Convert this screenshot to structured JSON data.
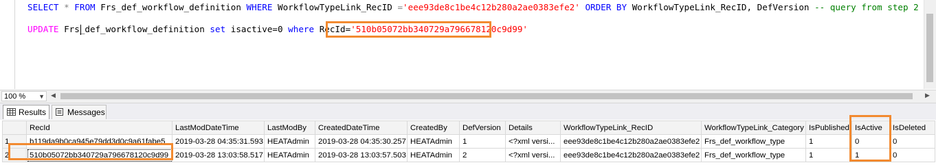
{
  "editor": {
    "line1": {
      "select": "SELECT",
      "star": "*",
      "from": "FROM",
      "table": "Frs_def_workflow_definition",
      "where": "WHERE",
      "col": "WorkflowTypeLink_RecID",
      "eq": "=",
      "value": "'eee93de8c1be4c12b280a2ae0383efe2'",
      "orderby": "ORDER BY",
      "order_cols": "WorkflowTypeLink_RecID, DefVersion",
      "comment": "-- query from step 2"
    },
    "line2": {
      "update": "UPDATE",
      "table": "Frs_def_workflow_definition",
      "set": "set",
      "assign": "isactive=0",
      "where": "where",
      "col": "RecId=",
      "value": "'510b05072bb340729a796678120c9d99'"
    }
  },
  "zoom": {
    "value": "100 %"
  },
  "tabs": [
    {
      "label": "Results",
      "icon": "grid-icon"
    },
    {
      "label": "Messages",
      "icon": "messages-icon"
    }
  ],
  "grid": {
    "columns": [
      "RecId",
      "LastModDateTime",
      "LastModBy",
      "CreatedDateTime",
      "CreatedBy",
      "DefVersion",
      "Details",
      "WorkflowTypeLink_RecID",
      "WorkflowTypeLink_Category",
      "IsPublished",
      "IsActive",
      "IsDeleted"
    ],
    "rows": [
      {
        "num": "1",
        "cells": [
          "b119da9b0ca945e79dd3d0c9a61fabe5",
          "2019-03-28 04:35:31.593",
          "HEATAdmin",
          "2019-03-28 04:35:30.257",
          "HEATAdmin",
          "1",
          "<?xml versi...",
          "eee93de8c1be4c12b280a2ae0383efe2",
          "Frs_def_workflow_type",
          "1",
          "0",
          "0"
        ]
      },
      {
        "num": "2",
        "cells": [
          "510b05072bb340729a796678120c9d99",
          "2019-03-28 13:03:58.517",
          "HEATAdmin",
          "2019-03-28 13:03:57.503",
          "HEATAdmin",
          "2",
          "<?xml versi...",
          "eee93de8c1be4c12b280a2ae0383efe2",
          "Frs_def_workflow_type",
          "1",
          "1",
          "0"
        ]
      }
    ]
  },
  "colors": {
    "highlight": "#f28a30",
    "keyword": "#0000ff",
    "string": "#ff0000",
    "comment": "#008000",
    "function": "#ff00ff"
  }
}
